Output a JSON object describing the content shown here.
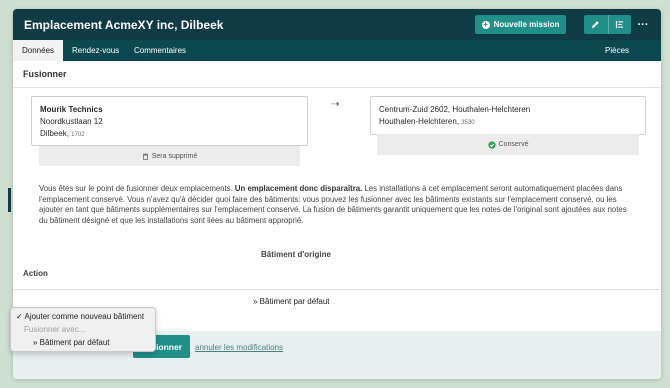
{
  "window": {
    "title": "Emplacement AcmeXY inc, Dilbeek"
  },
  "toolbar": {
    "new_mission_label": "Nouvelle mission",
    "edit_icon": "pencil-icon",
    "list_icon": "list-icon",
    "more_label": "···"
  },
  "tabs": [
    {
      "label": "Données",
      "active": true
    },
    {
      "label": "Rendez-vous",
      "active": false
    },
    {
      "label": "Commentaires",
      "active": false
    }
  ],
  "attachments_tab": "Pièces jointes",
  "section_title": "Fusionner",
  "source": {
    "name": "Mourik Technics",
    "street": "Noordkustlaan 12",
    "city": "Dilbeek",
    "postcode": "1702",
    "status": "Sera supprimé"
  },
  "target": {
    "street": "Centrum-Zuid 2602, Houthalen-Helchteren",
    "city": "Houthalen-Helchteren",
    "postcode": "3530",
    "status": "Conservé"
  },
  "arrow": "⇢",
  "message": {
    "part1": "Vous êtes sur le point de fusionner deux emplacements. ",
    "bold": "Un emplacement donc disparaîtra.",
    "part2": " Les installations à cet emplacement seront automatiquement placées dans l'emplacement conservé. Vous n'avez qu'à décider quoi faire des bâtiments: vous pouvez les fusionner avec les bâtiments existants sur l'emplacement conservé, ou les ajouter en tant que bâtiments supplémentaires sur l'emplacement conservé. La fusion de bâtiments garantit uniquement que les notes de l'original sont ajoutées aux notes du bâtiment désigné et que les installations sont liées au bâtiment approprié."
  },
  "table": {
    "column_header": "Bâtiment d'origine",
    "row_label": "Action",
    "row_value": "» Bâtiment par défaut"
  },
  "dropdown": {
    "options": [
      {
        "label": "✓ Ajouter comme nouveau bâtiment",
        "selected": true,
        "disabled": false
      },
      {
        "label": "Fusionner avec...",
        "selected": false,
        "disabled": true
      },
      {
        "label": "» Bâtiment par défaut",
        "selected": false,
        "disabled": false
      }
    ]
  },
  "actions": {
    "merge_label": "Fusionner",
    "cancel_label": "annuler les modifications"
  },
  "colors": {
    "header": "#0f3b45",
    "tabbar": "#0b4850",
    "accent": "#1f8f88",
    "status_ok": "#2aa55b"
  }
}
